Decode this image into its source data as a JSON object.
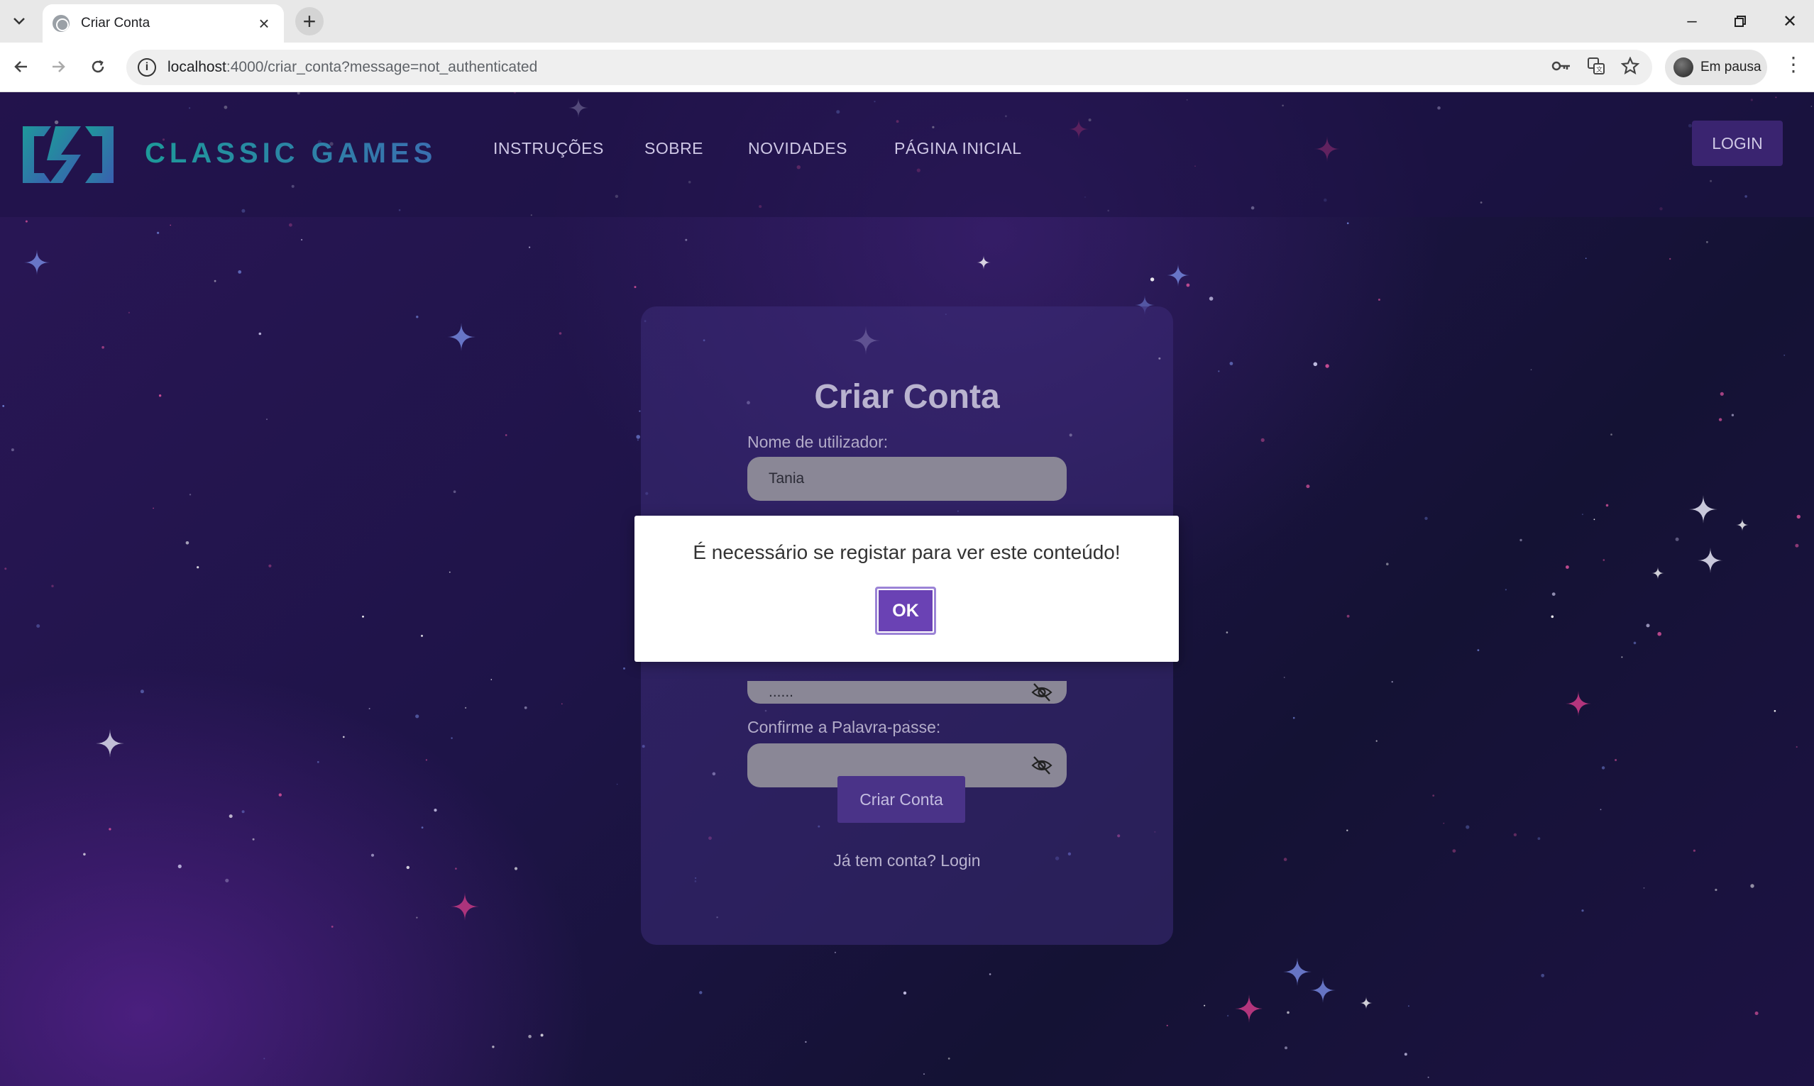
{
  "browser": {
    "tab_title": "Criar Conta",
    "url_host": "localhost",
    "url_rest": ":4000/criar_conta?message=not_authenticated",
    "profile_label": "Em pausa"
  },
  "header": {
    "logo_text": "CLASSIC GAMES",
    "nav": [
      "INSTRUÇÕES",
      "SOBRE",
      "NOVIDADES",
      "PÁGINA INICIAL"
    ],
    "login_label": "LOGIN"
  },
  "form": {
    "title": "Criar Conta",
    "username_label": "Nome de utilizador:",
    "username_value": "Tania",
    "password_value": "......",
    "confirm_label": "Confirme a Palavra-passe:",
    "confirm_value": "",
    "submit_label": "Criar Conta",
    "login_link": "Já tem conta? Login"
  },
  "modal": {
    "message": "É necessário se registar para ver este conteúdo!",
    "ok_label": "OK"
  },
  "colors": {
    "accent": "#6a42b4",
    "background": "#1e1448",
    "logo_teal": "#1d9a9a"
  }
}
